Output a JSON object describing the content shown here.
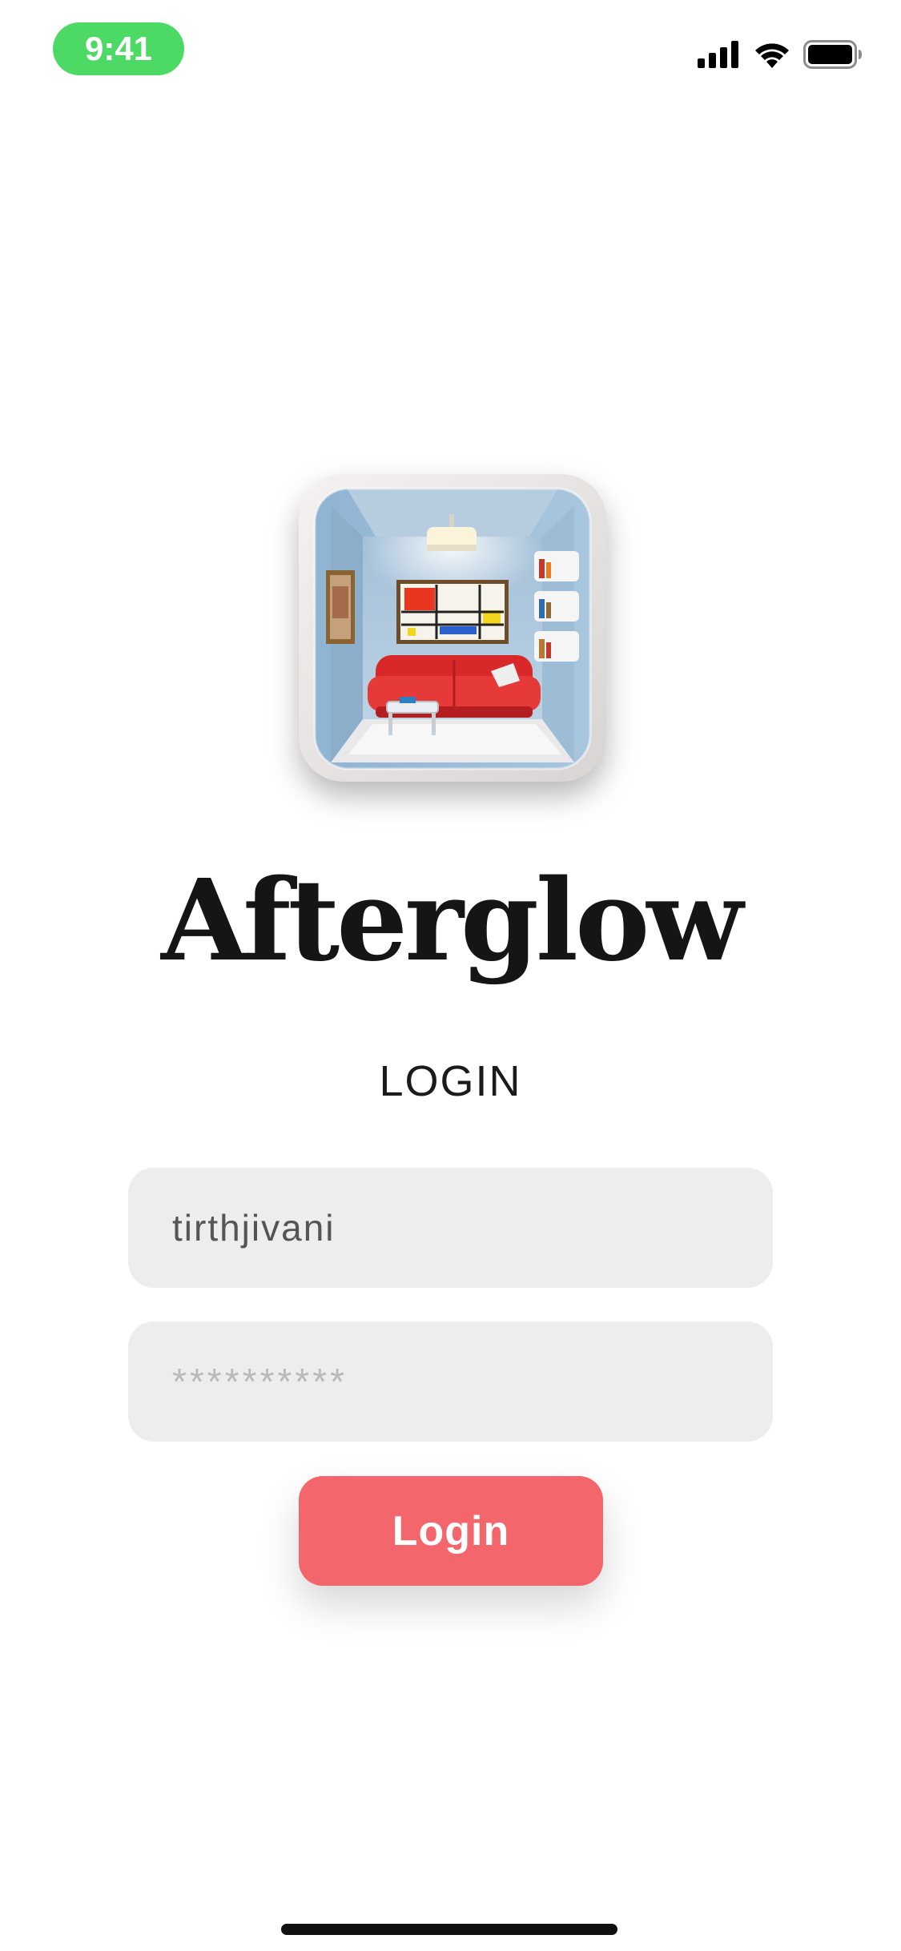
{
  "status_bar": {
    "time": "9:41",
    "time_pill_color": "#4cd964",
    "icons": [
      "cellular-signal-icon",
      "wifi-icon",
      "battery-icon"
    ]
  },
  "app": {
    "icon": "living-room-app-icon",
    "title": "Afterglow"
  },
  "login_form": {
    "heading": "LOGIN",
    "username_value": "tirthjivani",
    "password_placeholder": "**********",
    "submit_label": "Login",
    "submit_color": "#f3666c"
  }
}
